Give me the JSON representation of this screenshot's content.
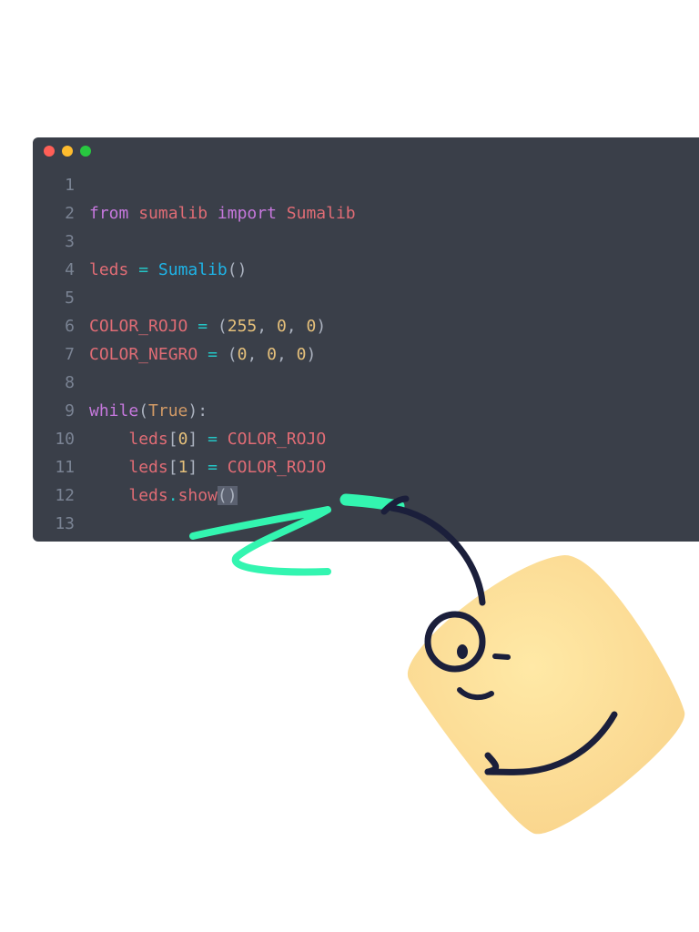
{
  "window": {
    "controls": [
      "close",
      "minimize",
      "maximize"
    ],
    "colors": {
      "close": "#ff5f57",
      "minimize": "#febc2e",
      "maximize": "#28c840",
      "background": "#3a3f49"
    }
  },
  "code": {
    "lines": [
      {
        "n": "1",
        "tokens": []
      },
      {
        "n": "2",
        "tokens": [
          {
            "t": "from",
            "c": "kw"
          },
          {
            "t": " ",
            "c": "punc"
          },
          {
            "t": "sumalib",
            "c": "var"
          },
          {
            "t": " ",
            "c": "punc"
          },
          {
            "t": "import",
            "c": "kw"
          },
          {
            "t": " ",
            "c": "punc"
          },
          {
            "t": "Sumalib",
            "c": "cls"
          }
        ]
      },
      {
        "n": "3",
        "tokens": []
      },
      {
        "n": "4",
        "tokens": [
          {
            "t": "leds",
            "c": "var"
          },
          {
            "t": " ",
            "c": "punc"
          },
          {
            "t": "=",
            "c": "op"
          },
          {
            "t": " ",
            "c": "punc"
          },
          {
            "t": "Sumalib",
            "c": "fn"
          },
          {
            "t": "()",
            "c": "punc"
          }
        ]
      },
      {
        "n": "5",
        "tokens": []
      },
      {
        "n": "6",
        "tokens": [
          {
            "t": "COLOR_ROJO",
            "c": "var"
          },
          {
            "t": " ",
            "c": "punc"
          },
          {
            "t": "=",
            "c": "op"
          },
          {
            "t": " ",
            "c": "punc"
          },
          {
            "t": "(",
            "c": "punc"
          },
          {
            "t": "255",
            "c": "num"
          },
          {
            "t": ", ",
            "c": "punc"
          },
          {
            "t": "0",
            "c": "num"
          },
          {
            "t": ", ",
            "c": "punc"
          },
          {
            "t": "0",
            "c": "num"
          },
          {
            "t": ")",
            "c": "punc"
          }
        ]
      },
      {
        "n": "7",
        "tokens": [
          {
            "t": "COLOR_NEGRO",
            "c": "var"
          },
          {
            "t": " ",
            "c": "punc"
          },
          {
            "t": "=",
            "c": "op"
          },
          {
            "t": " ",
            "c": "punc"
          },
          {
            "t": "(",
            "c": "punc"
          },
          {
            "t": "0",
            "c": "num"
          },
          {
            "t": ", ",
            "c": "punc"
          },
          {
            "t": "0",
            "c": "num"
          },
          {
            "t": ", ",
            "c": "punc"
          },
          {
            "t": "0",
            "c": "num"
          },
          {
            "t": ")",
            "c": "punc"
          }
        ]
      },
      {
        "n": "8",
        "tokens": []
      },
      {
        "n": "9",
        "tokens": [
          {
            "t": "while",
            "c": "kw"
          },
          {
            "t": "(",
            "c": "punc"
          },
          {
            "t": "True",
            "c": "builtin"
          },
          {
            "t": "):",
            "c": "punc"
          }
        ]
      },
      {
        "n": "10",
        "tokens": [
          {
            "t": "    ",
            "c": "punc"
          },
          {
            "t": "leds",
            "c": "var"
          },
          {
            "t": "[",
            "c": "punc"
          },
          {
            "t": "0",
            "c": "num"
          },
          {
            "t": "]",
            "c": "punc"
          },
          {
            "t": " ",
            "c": "punc"
          },
          {
            "t": "=",
            "c": "op"
          },
          {
            "t": " ",
            "c": "punc"
          },
          {
            "t": "COLOR_ROJO",
            "c": "var"
          }
        ]
      },
      {
        "n": "11",
        "tokens": [
          {
            "t": "    ",
            "c": "punc"
          },
          {
            "t": "leds",
            "c": "var"
          },
          {
            "t": "[",
            "c": "punc"
          },
          {
            "t": "1",
            "c": "num"
          },
          {
            "t": "]",
            "c": "punc"
          },
          {
            "t": " ",
            "c": "punc"
          },
          {
            "t": "=",
            "c": "op"
          },
          {
            "t": " ",
            "c": "punc"
          },
          {
            "t": "COLOR_ROJO",
            "c": "var"
          }
        ]
      },
      {
        "n": "12",
        "tokens": [
          {
            "t": "    ",
            "c": "punc"
          },
          {
            "t": "leds",
            "c": "var"
          },
          {
            "t": ".",
            "c": "op"
          },
          {
            "t": "show",
            "c": "var"
          },
          {
            "t": "()",
            "c": "punc sel"
          }
        ]
      },
      {
        "n": "13",
        "tokens": []
      }
    ]
  },
  "illustration": {
    "character": "square-smiley-mascot",
    "colors": {
      "body": "#fde29a",
      "outline": "#1b1f3b",
      "scribble": "#33f5b0"
    }
  }
}
